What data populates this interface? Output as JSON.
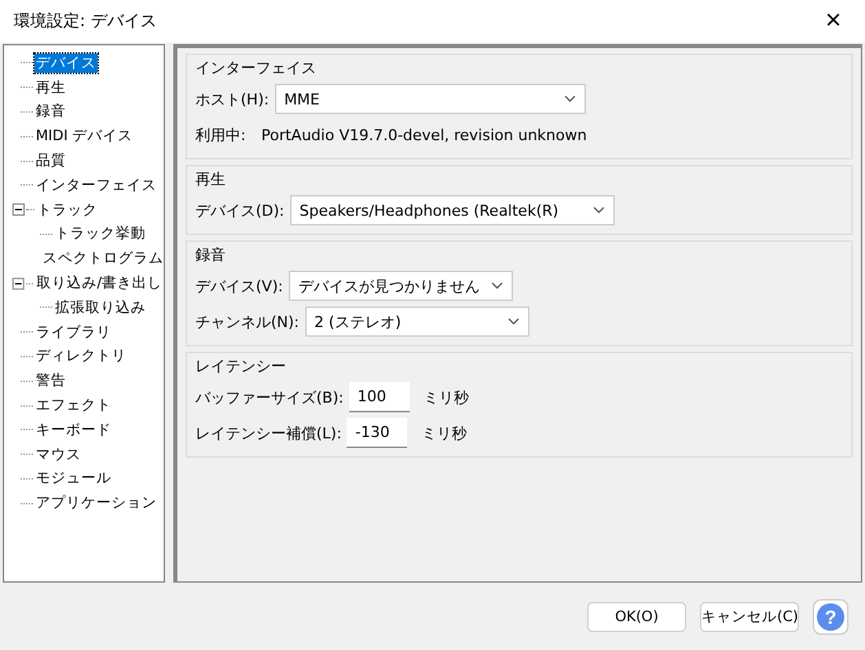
{
  "window": {
    "title": "環境設定: デバイス",
    "close": "×"
  },
  "tree": [
    {
      "label": "デバイス",
      "selected": true
    },
    {
      "label": "再生",
      "selected": false
    },
    {
      "label": "録音",
      "selected": false
    },
    {
      "label": "MIDI デバイス",
      "selected": false
    },
    {
      "label": "品質",
      "selected": false
    },
    {
      "label": "インターフェイス",
      "selected": false
    },
    {
      "label": "トラック",
      "selected": false,
      "expanded": true,
      "children": [
        {
          "label": "トラック挙動",
          "selected": false
        },
        {
          "label": "スペクトログラム",
          "selected": false
        }
      ]
    },
    {
      "label": "取り込み/書き出し",
      "selected": false,
      "expanded": true,
      "children": [
        {
          "label": "拡張取り込み",
          "selected": false
        }
      ]
    },
    {
      "label": "ライブラリ",
      "selected": false
    },
    {
      "label": "ディレクトリ",
      "selected": false
    },
    {
      "label": "警告",
      "selected": false
    },
    {
      "label": "エフェクト",
      "selected": false
    },
    {
      "label": "キーボード",
      "selected": false
    },
    {
      "label": "マウス",
      "selected": false
    },
    {
      "label": "モジュール",
      "selected": false
    },
    {
      "label": "アプリケーション",
      "selected": false
    }
  ],
  "groups": [
    {
      "title": "インターフェイス",
      "rows": [
        {
          "kind": "select",
          "label": "ホスト(H):",
          "value": "MME"
        },
        {
          "kind": "info",
          "label": "利用中:",
          "value": "PortAudio V19.7.0-devel, revision unknown"
        }
      ]
    },
    {
      "title": "再生",
      "rows": [
        {
          "kind": "select",
          "label": "デバイス(D):",
          "value": "Speakers/Headphones (Realtek(R)"
        }
      ]
    },
    {
      "title": "録音",
      "rows": [
        {
          "kind": "select",
          "label": "デバイス(V):",
          "value": "デバイスが見つかりません"
        },
        {
          "kind": "select",
          "label": "チャンネル(N):",
          "value": "2 (ステレオ)"
        }
      ]
    },
    {
      "title": "レイテンシー",
      "rows": [
        {
          "kind": "number",
          "label": "バッファーサイズ(B):",
          "value": "100",
          "unit": "ミリ秒"
        },
        {
          "kind": "number",
          "label": "レイテンシー補償(L):",
          "value": "-130",
          "unit": "ミリ秒"
        }
      ]
    }
  ],
  "buttons": [
    "OK(O)",
    "キャンセル(C)"
  ],
  "help": "?"
}
